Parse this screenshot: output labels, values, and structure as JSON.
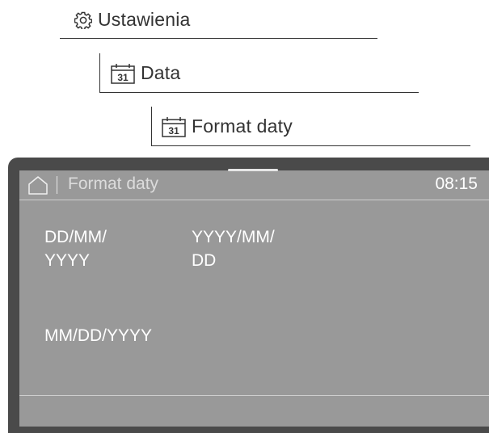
{
  "breadcrumb": {
    "settings_label": "Ustawienia",
    "date_label": "Data",
    "date_format_label": "Format daty",
    "calendar_icon_number": "31"
  },
  "screen": {
    "title": "Format daty",
    "time": "08:15",
    "options": [
      {
        "line1": "DD/MM/",
        "line2": "YYYY"
      },
      {
        "line1": "YYYY/MM/",
        "line2": "DD"
      },
      {
        "line1": "MM/DD/YYYY",
        "line2": ""
      }
    ]
  },
  "icons": [
    "gear-icon",
    "calendar-icon",
    "home-icon"
  ]
}
